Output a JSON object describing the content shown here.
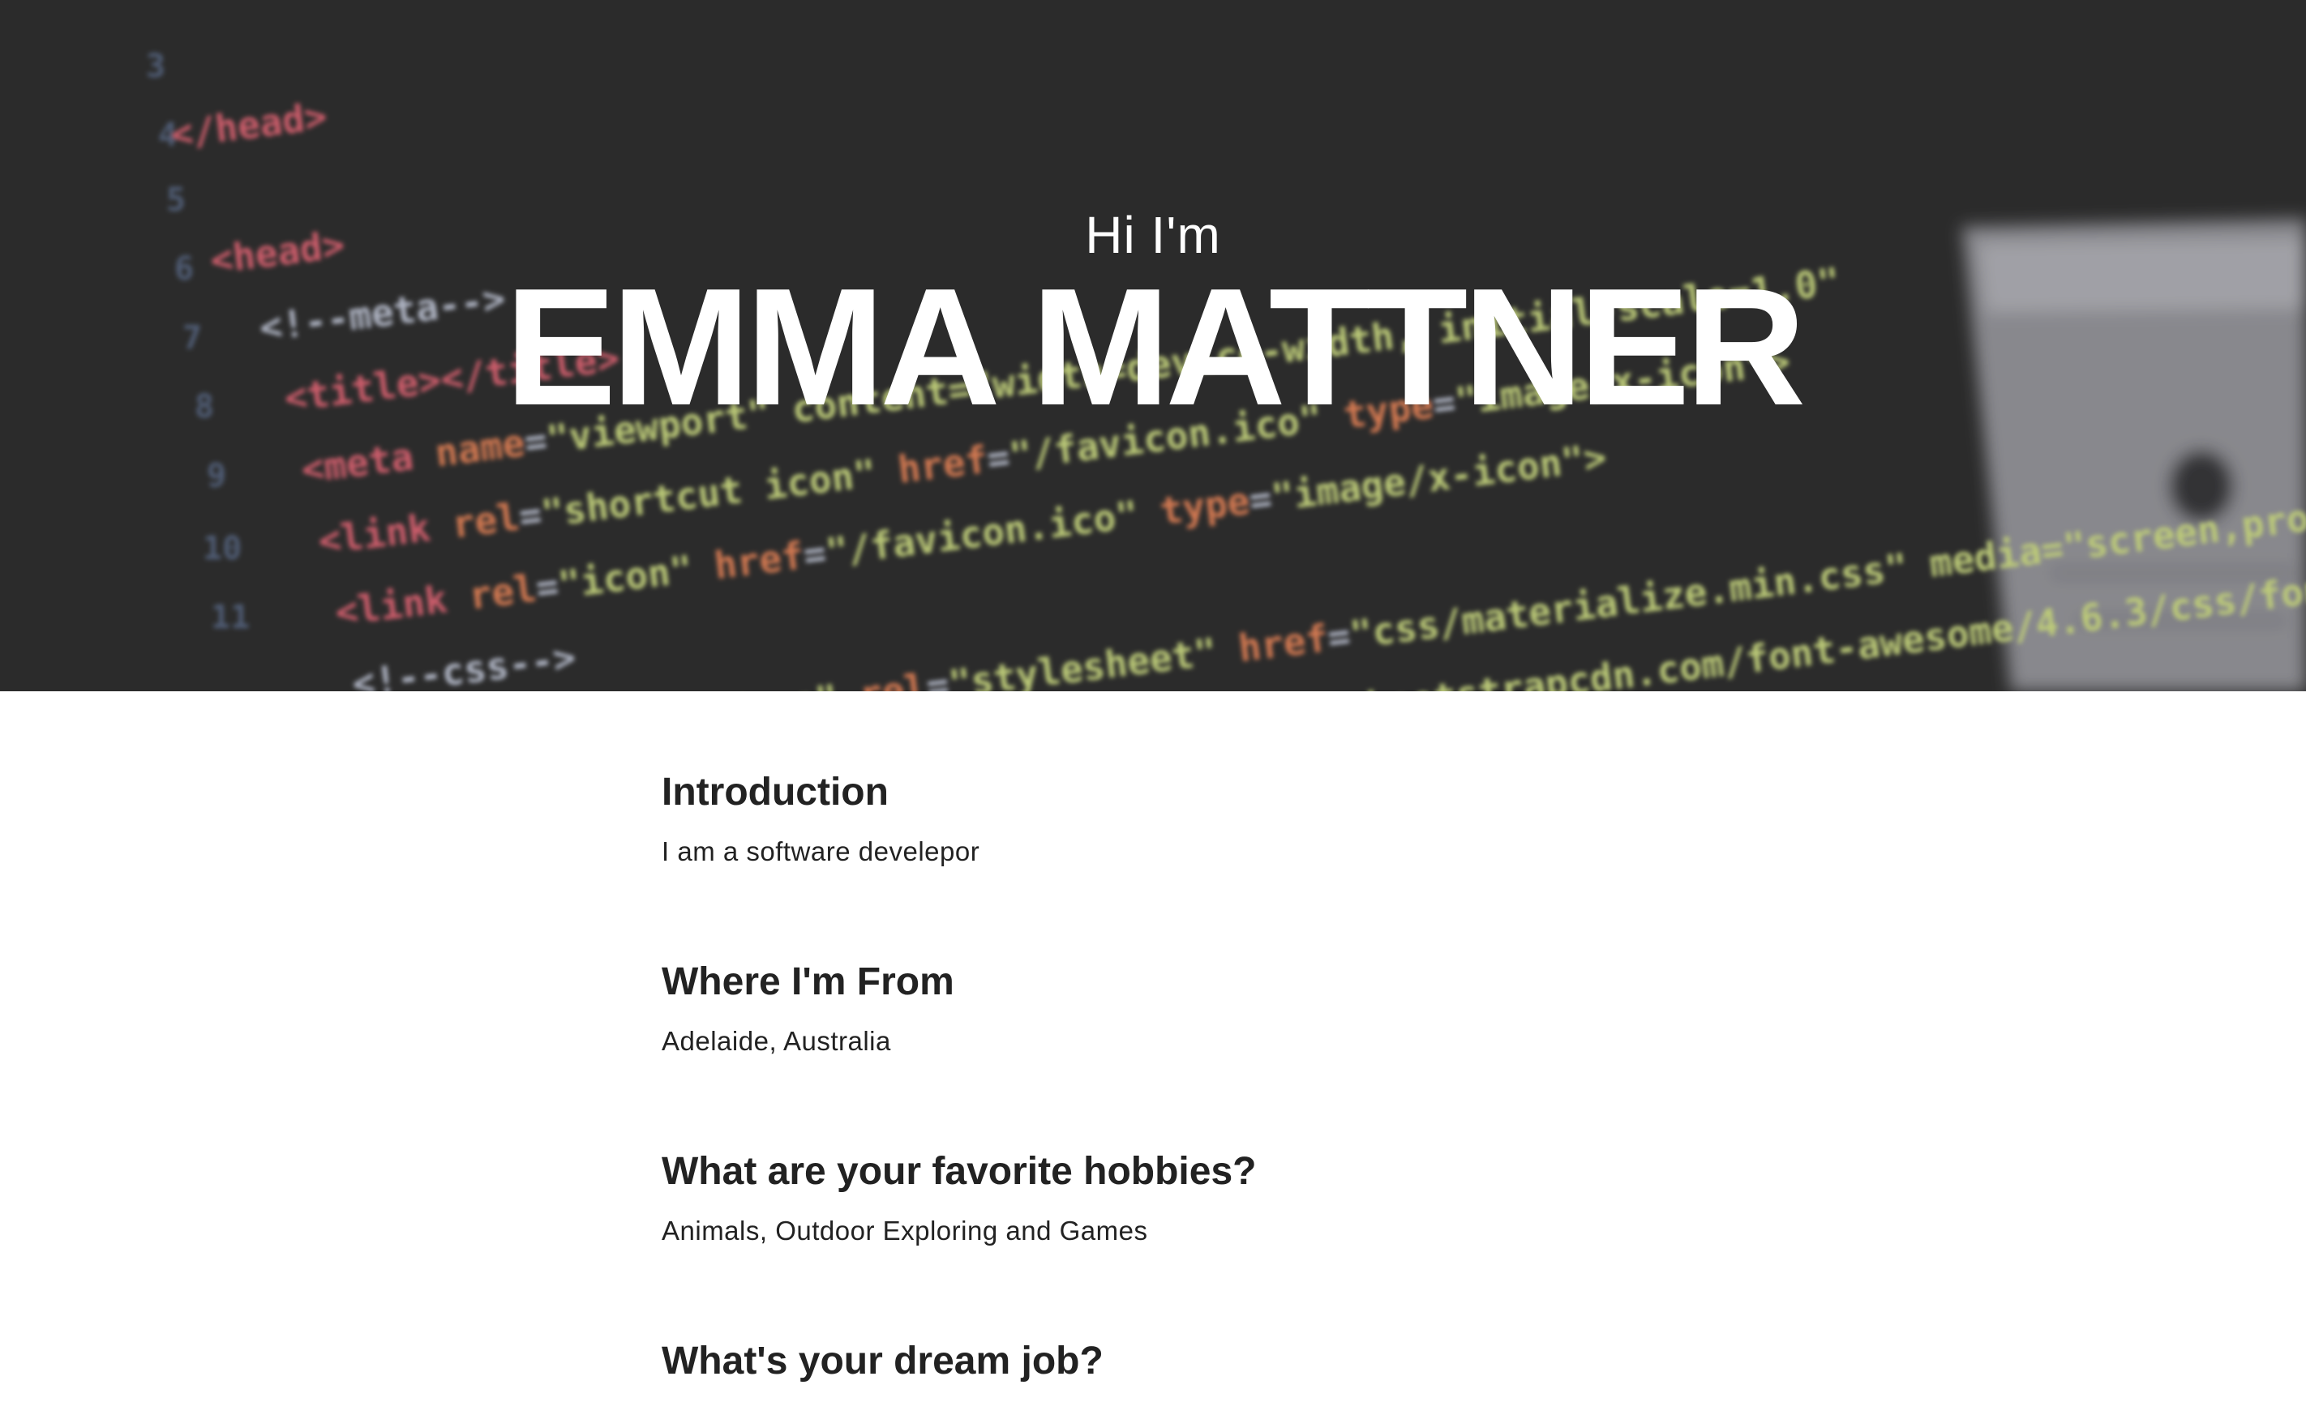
{
  "hero": {
    "greeting": "Hi I'm",
    "name": "EMMA MATTNER"
  },
  "sections": [
    {
      "heading": "Introduction",
      "text": "I am a software develepor"
    },
    {
      "heading": "Where I'm From",
      "text": "Adelaide, Australia"
    },
    {
      "heading": "What are your favorite hobbies?",
      "text": "Animals, Outdoor Exploring and Games"
    },
    {
      "heading": "What's your dream job?",
      "text": ""
    }
  ],
  "colors": {
    "hero_background": "#323232",
    "text": "#222222",
    "hero_text": "#ffffff",
    "code_tag": "#e96a7a",
    "code_attr": "#f08a5d",
    "code_string": "#d8e88a"
  }
}
